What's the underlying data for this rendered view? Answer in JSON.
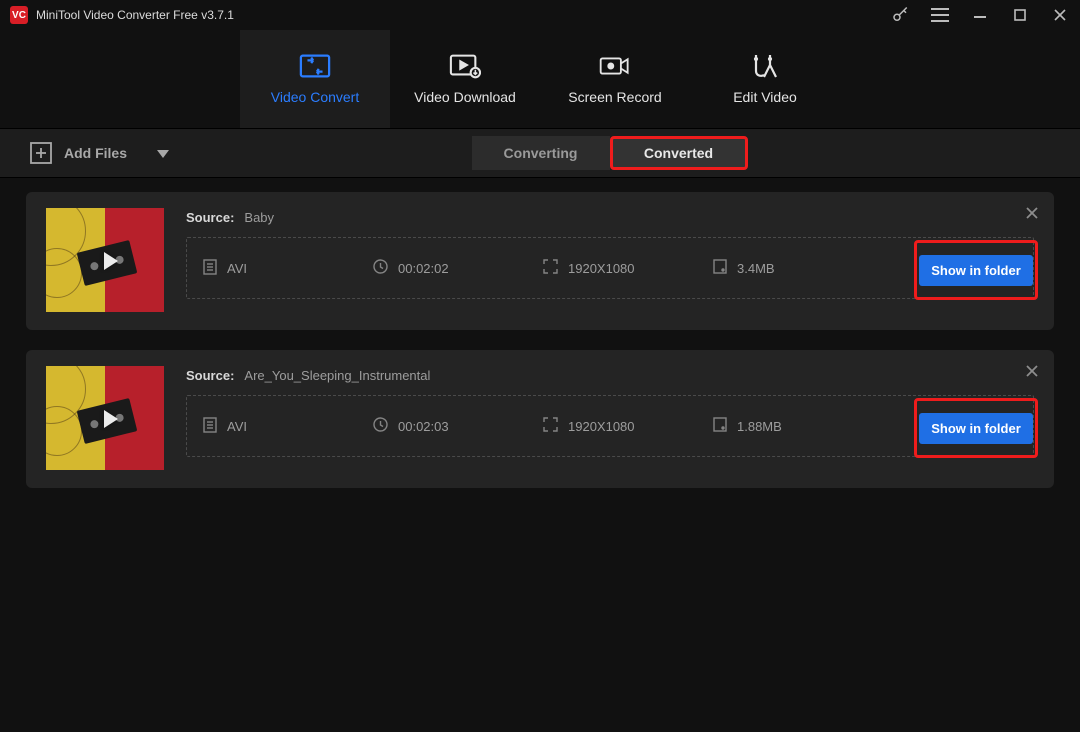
{
  "app": {
    "title": "MiniTool Video Converter Free v3.7.1"
  },
  "nav": {
    "convert": "Video Convert",
    "download": "Video Download",
    "record": "Screen Record",
    "edit": "Edit Video"
  },
  "toolbar": {
    "add_files": "Add Files",
    "converting": "Converting",
    "converted": "Converted"
  },
  "labels": {
    "source": "Source:",
    "show_in_folder": "Show in folder"
  },
  "items": [
    {
      "name": "Baby",
      "format": "AVI",
      "duration": "00:02:02",
      "resolution": "1920X1080",
      "size": "3.4MB"
    },
    {
      "name": "Are_You_Sleeping_Instrumental",
      "format": "AVI",
      "duration": "00:02:03",
      "resolution": "1920X1080",
      "size": "1.88MB"
    }
  ]
}
